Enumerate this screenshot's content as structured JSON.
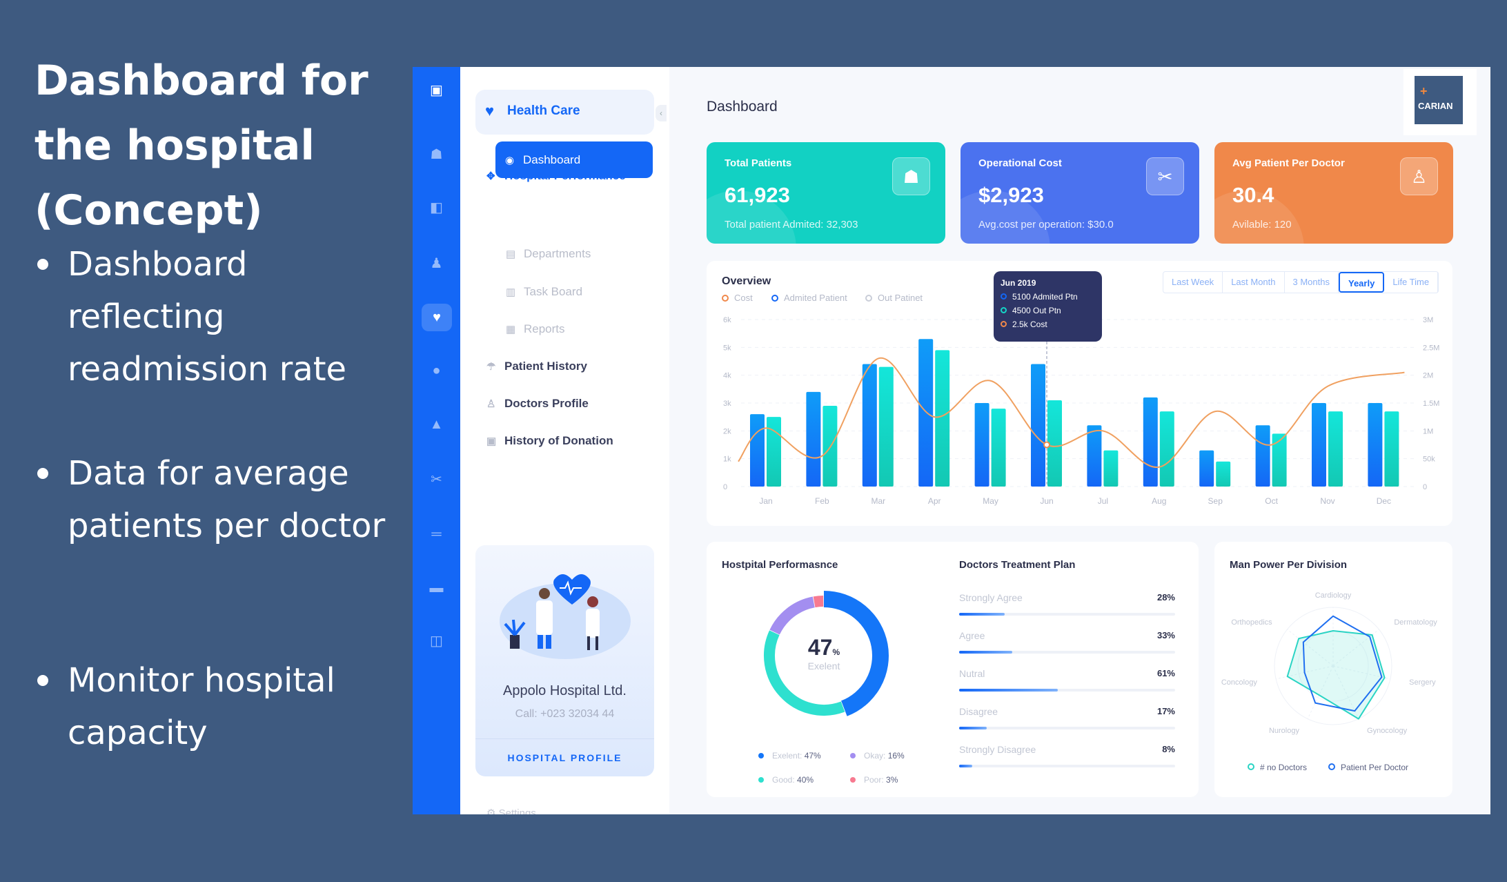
{
  "slide": {
    "title": "Dashboard for the hospital (Concept)",
    "bullets": [
      "Dashboard reflecting readmission rate",
      "Data for average patients per doctor",
      "Monitor hospital capacity"
    ]
  },
  "nav": {
    "brand": "Health Care",
    "section": "Hospital Performance",
    "active": "Dashboard",
    "sub": [
      "Departments",
      "Task Board",
      "Reports"
    ],
    "items": [
      "Patient History",
      "Doctors Profile",
      "History of Donation"
    ],
    "settings": "Settings"
  },
  "promo": {
    "name": "Appolo Hospital Ltd.",
    "call": "Call: +023 32034 44",
    "button": "HOSPITAL PROFILE"
  },
  "header": {
    "title": "Dashboard",
    "logo": "CARIAN"
  },
  "cards": [
    {
      "title": "Total Patients",
      "value": "61,923",
      "sub": "Total patient Admited: 32,303",
      "color": "#12d1c3"
    },
    {
      "title": "Operational Cost",
      "value": "$2,923",
      "sub": "Avg.cost per operation: $30.0",
      "color": "#4b72ef"
    },
    {
      "title": "Avg Patient Per Doctor",
      "value": "30.4",
      "sub": "Avilable: 120",
      "color": "#f0884a"
    }
  ],
  "overview": {
    "title": "Overview",
    "legend": [
      "Cost",
      "Admited Patient",
      "Out Patinet"
    ],
    "ranges": [
      "Last Week",
      "Last Month",
      "3 Months",
      "Yearly",
      "Life Time"
    ],
    "active_range": "Yearly",
    "tooltip": {
      "title": "Jun 2019",
      "lines": [
        "5100 Admited Ptn",
        "4500 Out Ptn",
        "2.5k Cost"
      ]
    }
  },
  "chart_data": {
    "type": "bar",
    "title": "Overview",
    "categories": [
      "Jan",
      "Feb",
      "Mar",
      "Apr",
      "May",
      "Jun",
      "Jul",
      "Aug",
      "Sep",
      "Oct",
      "Nov",
      "Dec"
    ],
    "series": [
      {
        "name": "Admited Patient",
        "values": [
          2600,
          3400,
          4400,
          5300,
          3000,
          4400,
          2200,
          3200,
          1300,
          2200,
          3000,
          3000
        ],
        "color": "#1467f6"
      },
      {
        "name": "Out Patinet",
        "values": [
          2500,
          2900,
          4300,
          4900,
          2800,
          3100,
          1300,
          2700,
          900,
          1900,
          2700,
          2700
        ],
        "color": "#14d8c8"
      },
      {
        "name": "Cost",
        "axis": "right",
        "values": [
          1.05,
          0.55,
          2.3,
          1.25,
          1.9,
          0.75,
          1.0,
          0.35,
          1.35,
          0.75,
          1.8,
          2.05
        ],
        "color": "#f0a060"
      }
    ],
    "yticks_left": [
      "0",
      "1k",
      "2k",
      "3k",
      "4k",
      "5k",
      "6k"
    ],
    "yticks_right": [
      "0",
      "50k",
      "1M",
      "1.5M",
      "2M",
      "2.5M",
      "3M"
    ],
    "ylim": [
      0,
      6000
    ],
    "ylim_right": [
      0,
      3
    ]
  },
  "performance": {
    "title": "Hostpital Performasnce",
    "center_value": "47",
    "center_unit": "%",
    "center_label": "Exelent",
    "segments": [
      {
        "label": "Exelent:",
        "value": "47%",
        "n": 47,
        "color": "#1476f8"
      },
      {
        "label": "Good:",
        "value": "40%",
        "n": 40,
        "color": "#2ee0cf"
      },
      {
        "label": "Okay:",
        "value": "16%",
        "n": 16,
        "color": "#a38ef0"
      },
      {
        "label": "Poor:",
        "value": "3%",
        "n": 3,
        "color": "#f77a90"
      }
    ]
  },
  "treatment": {
    "title": "Doctors Treatment Plan",
    "rows": [
      {
        "label": "Strongly Agree",
        "value": "28%",
        "n": 28
      },
      {
        "label": "Agree",
        "value": "33%",
        "n": 33
      },
      {
        "label": "Nutral",
        "value": "61%",
        "n": 61
      },
      {
        "label": "Disagree",
        "value": "17%",
        "n": 17
      },
      {
        "label": "Strongly Disagree",
        "value": "8%",
        "n": 8
      }
    ]
  },
  "manpower": {
    "title": "Man Power Per Division",
    "axes": [
      "Cardiology",
      "Dermatology",
      "Sergery",
      "Gynocology",
      "Nurology",
      "Concology",
      "Orthopedics"
    ],
    "series": [
      {
        "name": "# no Doctors",
        "values": [
          0.6,
          0.85,
          0.9,
          1.0,
          0.55,
          0.8,
          0.75
        ],
        "color": "#2ad4c4"
      },
      {
        "name": "Patient Per Doctor",
        "values": [
          0.85,
          0.8,
          0.85,
          0.85,
          0.7,
          0.5,
          0.65
        ],
        "color": "#1f6ff0"
      }
    ]
  }
}
